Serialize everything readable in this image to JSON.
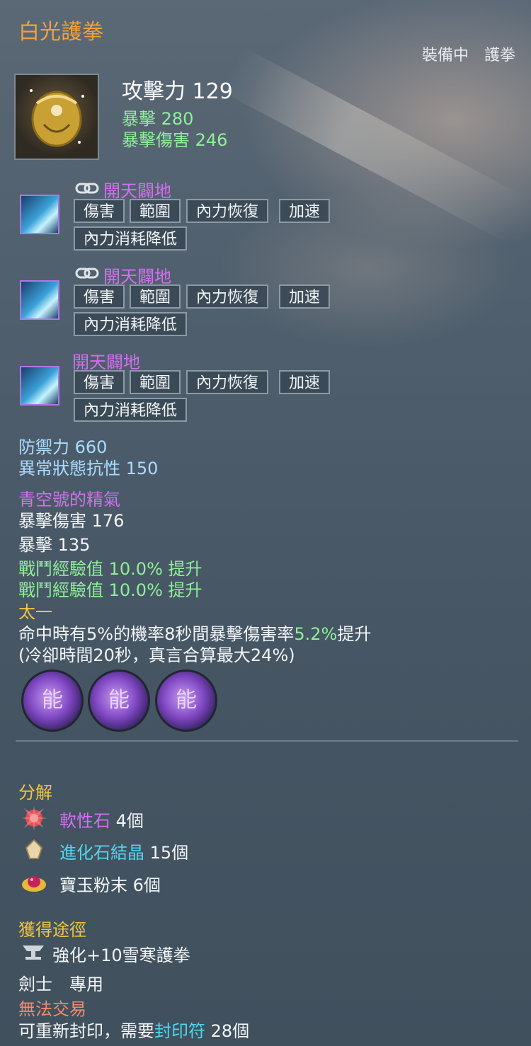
{
  "item": {
    "name": "白光護拳",
    "equipped_label": "裝備中　護拳",
    "icon": "golden-gauntlet-icon",
    "attack_label": "攻擊力",
    "attack_value": "129",
    "crit_label": "暴擊",
    "crit_value": "280",
    "crit_dmg_label": "暴擊傷害",
    "crit_dmg_value": "246"
  },
  "skills": [
    {
      "name": "開天闢地",
      "linked": true,
      "icon": "sword-slash-skill-icon",
      "tags": [
        "傷害",
        "範圍",
        "內力恢復",
        "加速"
      ],
      "tags2": [
        "內力消耗降低"
      ]
    },
    {
      "name": "開天闢地",
      "linked": true,
      "icon": "sword-slash-skill-icon",
      "tags": [
        "傷害",
        "範圍",
        "內力恢復",
        "加速"
      ],
      "tags2": [
        "內力消耗降低"
      ]
    },
    {
      "name": "開天闢地",
      "linked": false,
      "icon": "sword-slash-skill-icon",
      "tags": [
        "傷害",
        "範圍",
        "內力恢復",
        "加速"
      ],
      "tags2": [
        "內力消耗降低"
      ]
    }
  ],
  "defense": {
    "def_label": "防禦力",
    "def_value": "660",
    "res_label": "異常狀態抗性",
    "res_value": "150"
  },
  "spirit": {
    "title": "青空號的精氣",
    "line1_label": "暴擊傷害",
    "line1_value": "176",
    "line2_label": "暴擊",
    "line2_value": "135",
    "line3_label": "戰鬥經驗值",
    "line3_value": "10.0%",
    "line3_suffix": "提升",
    "line4_label": "戰鬥經驗值",
    "line4_value": "10.0%",
    "line4_suffix": "提升"
  },
  "effect": {
    "title": "太一",
    "desc_part1": "命中時有5%的機率8秒間暴擊傷害率",
    "desc_highlight": "5.2%",
    "desc_part2": "提升",
    "desc_line2": "(冷卻時間20秒，真言合算最大24%)"
  },
  "gems": [
    {
      "glyph": "能",
      "icon": "purple-gem-slot-icon"
    },
    {
      "glyph": "能",
      "icon": "purple-gem-slot-icon"
    },
    {
      "glyph": "能",
      "icon": "purple-gem-slot-icon"
    }
  ],
  "decompose": {
    "title": "分解",
    "items": [
      {
        "name": "軟性石",
        "count": "4個",
        "color": "#d46ef0",
        "icon": "soft-stone-icon"
      },
      {
        "name": "進化石結晶",
        "count": "15個",
        "color": "#4fd8f0",
        "icon": "evolution-crystal-icon"
      },
      {
        "name": "寶玉粉末",
        "count": "6個",
        "color": "#f3f6f8",
        "icon": "jade-powder-icon"
      }
    ]
  },
  "acquire": {
    "title": "獲得途徑",
    "source": "強化+10雪寒護拳",
    "source_icon": "anvil-icon",
    "class_only": "劍士　專用",
    "untradeable": "無法交易",
    "reseal_prefix": "可重新封印，需要",
    "reseal_item": "封印符",
    "reseal_count": "28個"
  },
  "colors": {
    "title": "#f2a23a",
    "section": "#f0c542",
    "skill": "#d46ef0",
    "green": "#8ff09a",
    "blue": "#a9dcff",
    "untradeable": "#f08a6a",
    "cyan": "#4fd8f0"
  }
}
